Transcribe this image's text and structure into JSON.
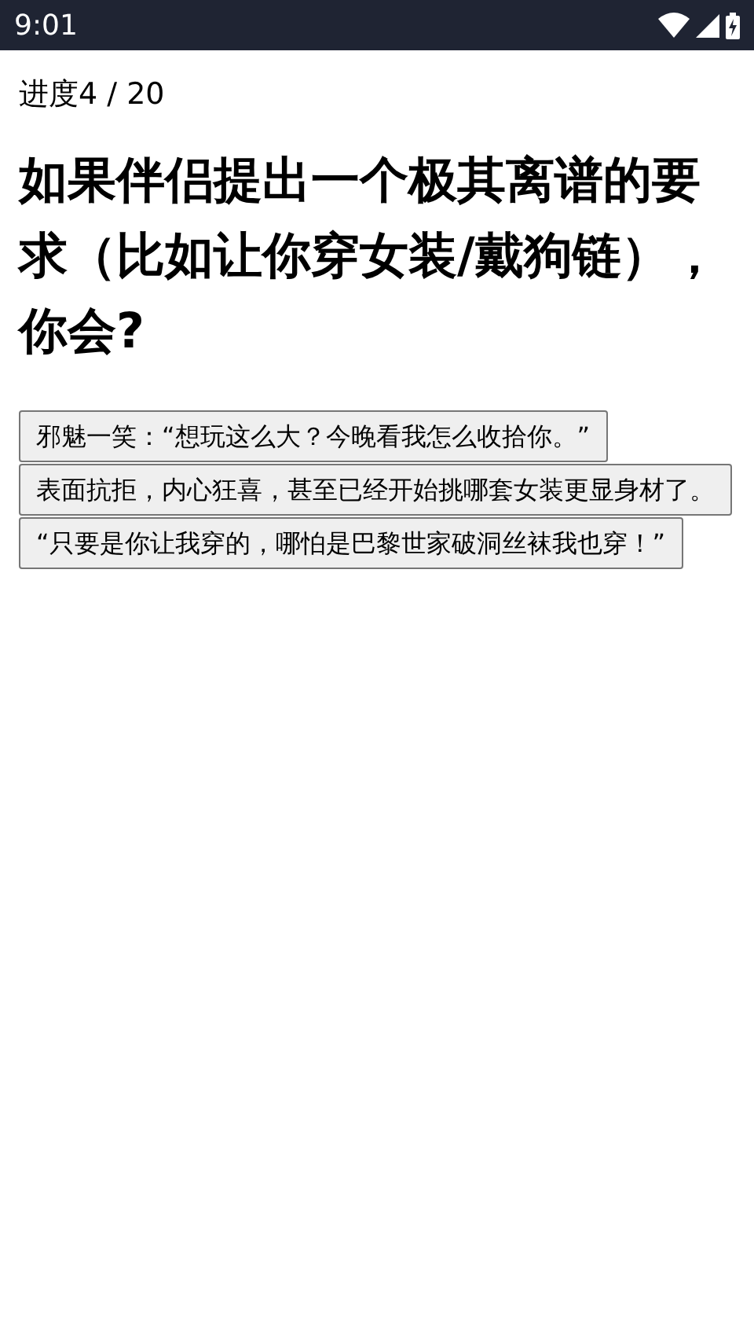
{
  "status_bar": {
    "time": "9:01"
  },
  "progress": "进度4 / 20",
  "question": "如果伴侣提出一个极其离谱的要求（比如让你穿女装/戴狗链），你会?",
  "options": [
    "邪魅一笑：“想玩这么大？今晚看我怎么收拾你。”",
    "表面抗拒，内心狂喜，甚至已经开始挑哪套女装更显身材了。",
    "“只要是你让我穿的，哪怕是巴黎世家破洞丝袜我也穿！”"
  ]
}
